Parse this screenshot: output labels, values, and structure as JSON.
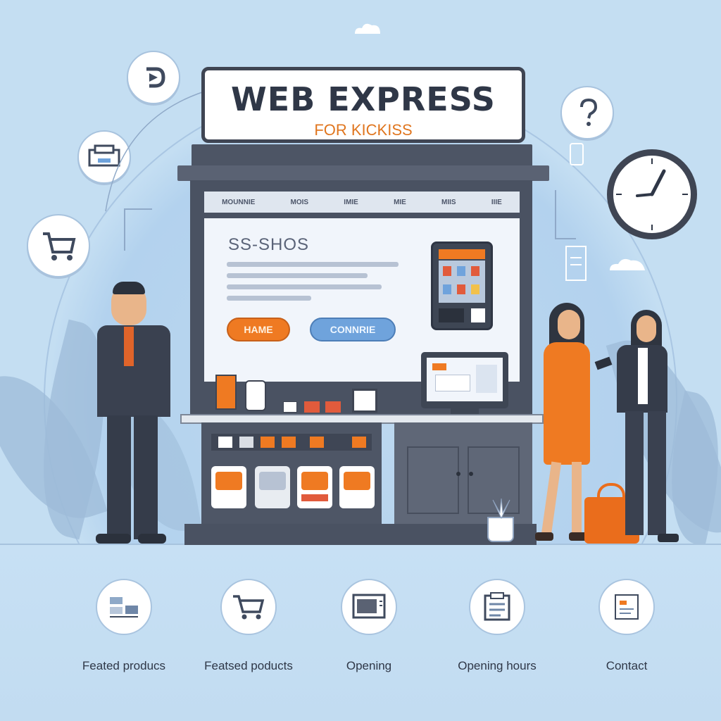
{
  "sign": {
    "title": "WEB EXPRESS",
    "subtitle": "FOR KICKISS"
  },
  "kiosk": {
    "nav_items": [
      "MOUNNIE",
      "MOIS",
      "IMIE",
      "MIE",
      "MIIS",
      "IIIE"
    ],
    "screen_title": "SS-SHOS",
    "home_button": "HAME",
    "continue_button": "CONNRIE"
  },
  "floating_icons": [
    "refresh-icon",
    "printer-icon",
    "shopping-cart-icon",
    "question-icon",
    "clock-icon"
  ],
  "features": [
    {
      "label": "Feated producs",
      "icon": "product-list-icon"
    },
    {
      "label": "Featsed poducts",
      "icon": "shopping-cart-icon"
    },
    {
      "label": "Opening",
      "icon": "window-icon"
    },
    {
      "label": "Opening hours",
      "icon": "clipboard-icon"
    },
    {
      "label": "Contact",
      "icon": "contact-card-icon"
    }
  ],
  "colors": {
    "background": "#c4def2",
    "kiosk": "#4a5262",
    "accent_orange": "#ef7a22",
    "accent_blue": "#6fa3dc",
    "text_dark": "#2f3747"
  }
}
